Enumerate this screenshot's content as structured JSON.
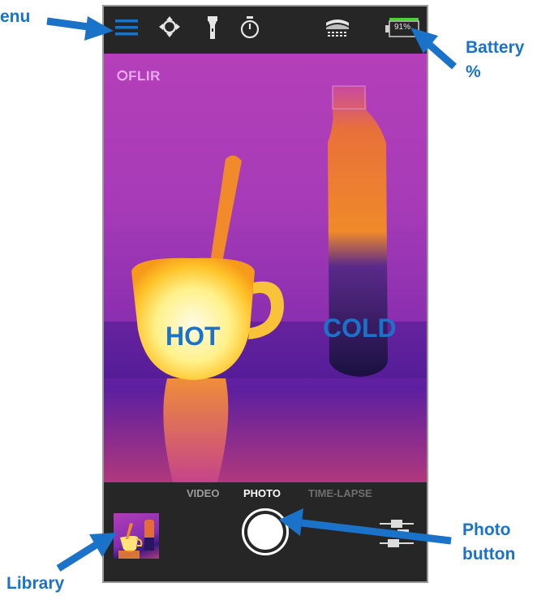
{
  "annotations": {
    "menu": "enu",
    "battery_line1": "Battery",
    "battery_line2": "%",
    "photo_line1": "Photo",
    "photo_line2": "button",
    "library": "Library"
  },
  "toolbar": {
    "icons": [
      "menu-icon",
      "crosshair-icon",
      "flashlight-icon",
      "timer-icon",
      "palette-icon",
      "battery-icon"
    ],
    "battery_text": "91%"
  },
  "viewfinder": {
    "logo": "⭘FLIR",
    "hot_label": "HOT",
    "cold_label": "COLD"
  },
  "modes": {
    "video": "VIDEO",
    "photo": "PHOTO",
    "timelapse": "TIME-LAPSE",
    "active": "PHOTO"
  },
  "colors": {
    "accent": "#1a73c9",
    "bar": "#262626",
    "battery_green": "#4fcf3a"
  }
}
